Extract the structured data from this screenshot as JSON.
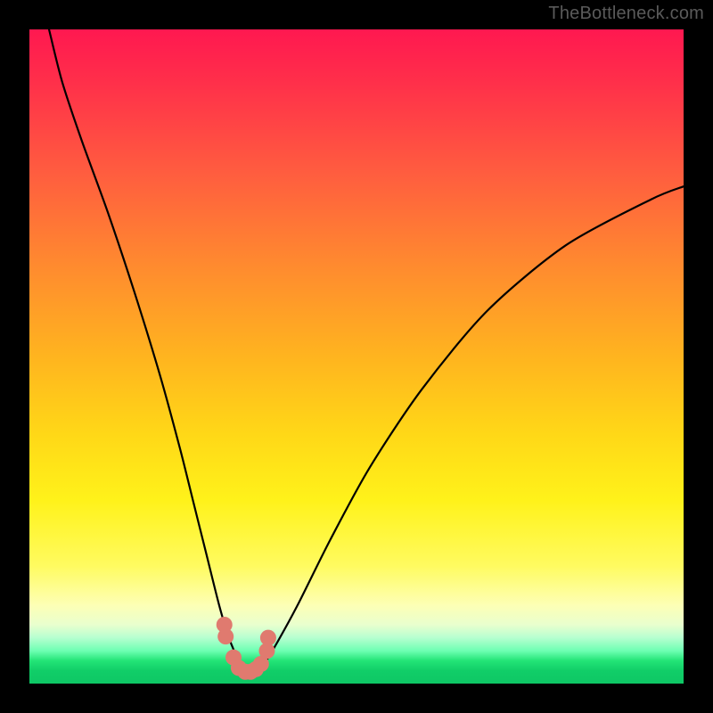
{
  "watermark": "TheBottleneck.com",
  "chart_data": {
    "type": "line",
    "title": "",
    "xlabel": "",
    "ylabel": "",
    "xlim": [
      0,
      100
    ],
    "ylim": [
      0,
      100
    ],
    "grid": false,
    "series": [
      {
        "name": "bottleneck-curve",
        "x": [
          3,
          5,
          8,
          12,
          16,
          20,
          23,
          25,
          27,
          29,
          30.5,
          32,
          33,
          34,
          35,
          36,
          38,
          41,
          46,
          52,
          60,
          70,
          82,
          95,
          100
        ],
        "values": [
          100,
          92,
          83,
          72,
          60,
          47,
          36,
          28,
          20,
          12,
          7,
          3.5,
          2,
          1.6,
          2,
          3.2,
          6.5,
          12,
          22,
          33,
          45,
          57,
          67,
          74,
          76
        ]
      }
    ],
    "markers": {
      "name": "highlighted-points",
      "color": "#e07a6f",
      "x": [
        29.8,
        30.0,
        31.2,
        32.0,
        33.0,
        33.8,
        34.6,
        35.4,
        36.3,
        36.5
      ],
      "values": [
        9.0,
        7.2,
        4.0,
        2.4,
        1.8,
        1.8,
        2.2,
        3.0,
        5.0,
        7.0
      ]
    },
    "gradient_stops": [
      {
        "pos": 0.0,
        "color": "#ff1850"
      },
      {
        "pos": 0.22,
        "color": "#ff5d3f"
      },
      {
        "pos": 0.5,
        "color": "#ffb41f"
      },
      {
        "pos": 0.72,
        "color": "#fff21a"
      },
      {
        "pos": 0.9,
        "color": "#e9ffce"
      },
      {
        "pos": 0.97,
        "color": "#23e477"
      },
      {
        "pos": 1.0,
        "color": "#0ec765"
      }
    ]
  }
}
